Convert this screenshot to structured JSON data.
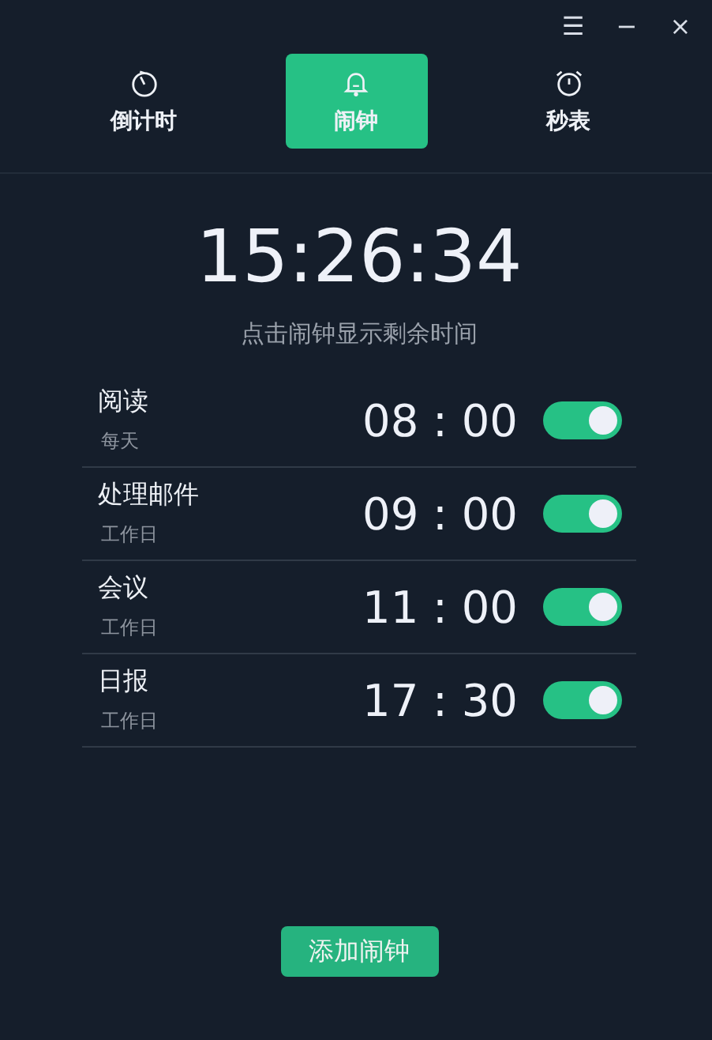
{
  "window_controls": [
    "☰",
    "−",
    "×"
  ],
  "tabs": [
    {
      "label": "倒计时",
      "kind": "timer",
      "selected": false
    },
    {
      "label": "闹钟",
      "kind": "bell",
      "selected": true
    },
    {
      "label": "秒表",
      "kind": "stopwatch",
      "selected": false
    }
  ],
  "clock": "15:26:34",
  "hint": "点击闹钟显示剩余时间",
  "alarms": [
    {
      "name": "阅读",
      "repeat": "每天",
      "time": "08 : 00",
      "on": true
    },
    {
      "name": "处理邮件",
      "repeat": "工作日",
      "time": "09 : 00",
      "on": true
    },
    {
      "name": "会议",
      "repeat": "工作日",
      "time": "11 : 00",
      "on": true
    },
    {
      "name": "日报",
      "repeat": "工作日",
      "time": "17 : 30",
      "on": true
    }
  ],
  "add_button": "添加闹钟"
}
